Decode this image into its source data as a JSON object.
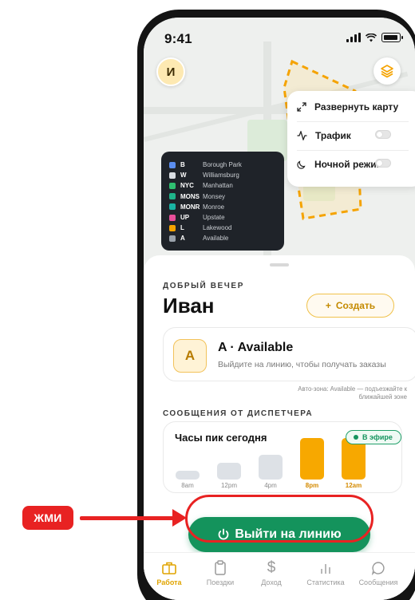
{
  "status_bar": {
    "time": "9:41"
  },
  "user": {
    "initial": "И",
    "greeting": "ДОБРЫЙ ВЕЧЕР",
    "name": "Иван"
  },
  "map_menu": {
    "expand": "Развернуть карту",
    "traffic": "Трафик",
    "night": "Ночной режим"
  },
  "legend": [
    {
      "code": "B",
      "name": "Borough Park",
      "color": "#5b8def"
    },
    {
      "code": "W",
      "name": "Williamsburg",
      "color": "#d9dde2"
    },
    {
      "code": "NYC",
      "name": "Manhattan",
      "color": "#2fbf71"
    },
    {
      "code": "MONS",
      "name": "Monsey",
      "color": "#1fb58a"
    },
    {
      "code": "MONR",
      "name": "Monroe",
      "color": "#19b3a3"
    },
    {
      "code": "UP",
      "name": "Upstate",
      "color": "#e84f9a"
    },
    {
      "code": "L",
      "name": "Lakewood",
      "color": "#f5a300"
    },
    {
      "code": "A",
      "name": "Available",
      "color": "#9aa2ab"
    }
  ],
  "create_button": {
    "icon": "+",
    "label": "Создать"
  },
  "zone": {
    "badge": "A",
    "title": "A · Available",
    "subtitle": "Выйдите на линию, чтобы получать заказы",
    "auto_line1": "Авто-зона: Available — подъезжайте к",
    "auto_line2": "ближайшей зоне"
  },
  "dispatcher": {
    "section_title": "СООБЩЕНИЯ ОТ ДИСПЕТЧЕРА",
    "card_title": "Часы пик сегодня",
    "live_label": "В эфире"
  },
  "chart_data": {
    "type": "bar",
    "categories": [
      "8am",
      "12pm",
      "4pm",
      "8pm",
      "12am"
    ],
    "values": [
      1,
      2,
      3,
      5,
      5
    ],
    "highlighted": [
      "8pm",
      "12am"
    ],
    "colors": {
      "normal": "#dde1e6",
      "peak": "#f7a800"
    }
  },
  "cta": {
    "label": "Выйти на линию"
  },
  "tabs": [
    {
      "label": "Работа",
      "icon": "briefcase-icon",
      "active": true
    },
    {
      "label": "Поездки",
      "icon": "clipboard-icon",
      "active": false
    },
    {
      "label": "Доход",
      "icon": "dollar-icon",
      "active": false
    },
    {
      "label": "Статистика",
      "icon": "bar-chart-icon",
      "active": false
    },
    {
      "label": "Сообщения",
      "icon": "message-icon",
      "active": false
    }
  ],
  "annotation": {
    "label": "ЖМИ",
    "color": "#e82222"
  },
  "colors": {
    "accent": "#f5a300",
    "primary": "#14935c"
  }
}
